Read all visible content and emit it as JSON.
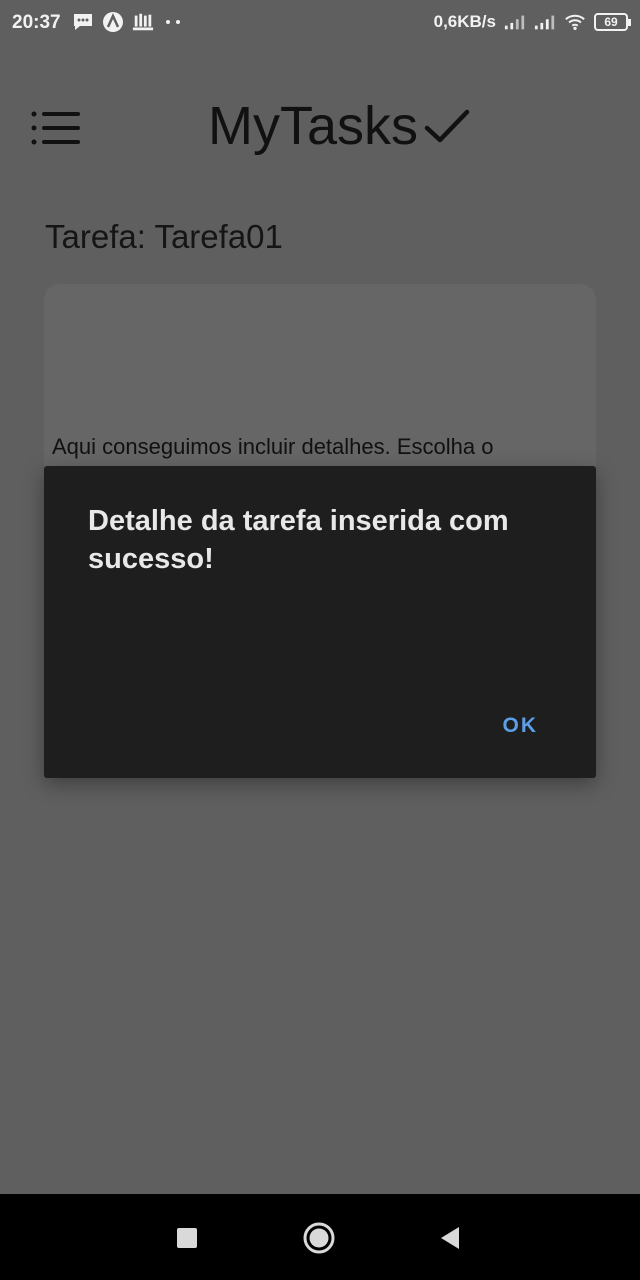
{
  "status_bar": {
    "time": "20:37",
    "network_speed": "0,6KB/s",
    "battery_level": "69",
    "icons": [
      "message-icon",
      "app-a-icon",
      "library-icon",
      "more-dots-icon",
      "signal-icon",
      "signal-icon-2",
      "wifi-icon",
      "battery-icon"
    ]
  },
  "header": {
    "app_title": "MyTasks",
    "menu_icon": "hamburger-menu-icon",
    "title_icon": "checkmark-icon"
  },
  "task": {
    "label": "Tarefa: Tarefa01",
    "detail_text": "Aqui conseguimos incluir detalhes. Escolha o"
  },
  "dialog": {
    "message": "Detalhe da tarefa inserida com sucesso!",
    "ok_label": "OK"
  },
  "nav_bar": {
    "icons": [
      "recent-apps-icon",
      "home-icon",
      "back-icon"
    ]
  },
  "colors": {
    "background": "#5f5f5f",
    "dialog_bg": "#1e1e1e",
    "dialog_accent": "#5b9fe6",
    "card_bg": "#666666"
  }
}
